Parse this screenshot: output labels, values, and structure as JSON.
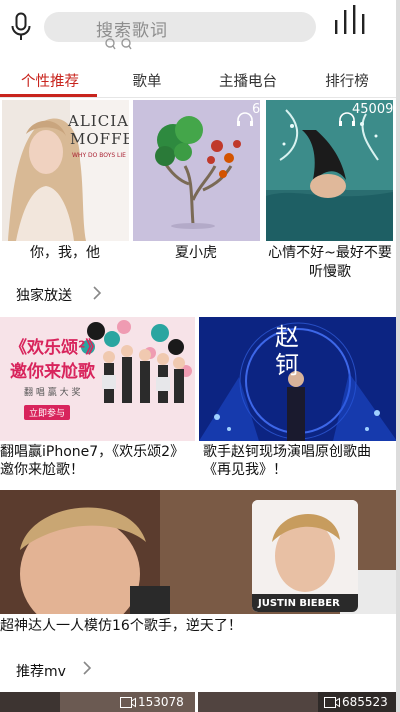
{
  "search": {
    "placeholder": "搜索歌词"
  },
  "tabs": [
    {
      "label": "个性推荐",
      "active": true
    },
    {
      "label": "歌单",
      "active": false
    },
    {
      "label": "主播电台",
      "active": false
    },
    {
      "label": "排行榜",
      "active": false
    }
  ],
  "playlists": [
    {
      "title": "你，我，他",
      "cover_text_1": "ALICIA",
      "cover_text_2": "MOFFET",
      "cover_text_3": "WHY DO BOYS LIE",
      "play_count": ""
    },
    {
      "title": "夏小虎",
      "play_count": "6"
    },
    {
      "title": "心情不好~最好不要听慢歌",
      "play_count": "45009"
    }
  ],
  "exclusive": {
    "title": "独家放送",
    "items": [
      {
        "caption": "翻唱赢iPhone7，《欢乐颂2》邀你来尬歌！",
        "banner_line1": "《欢乐颂²》",
        "banner_line2": "邀你来尬歌",
        "banner_line3": "翻 唱 赢 大 奖",
        "banner_button": "立即参与"
      },
      {
        "caption": "歌手赵钶现场演唱原创歌曲《再见我》！",
        "banner_text": "赵钶"
      }
    ],
    "wide": {
      "caption": "超神达人一人模仿16个歌手，逆天了！",
      "overlay_label": "JUSTIN BIEBER"
    }
  },
  "mv": {
    "title": "推荐mv",
    "items": [
      {
        "play_count": "153078"
      },
      {
        "play_count": "685523"
      }
    ]
  },
  "colors": {
    "accent": "#c8241d",
    "tab_text": "#333333"
  }
}
